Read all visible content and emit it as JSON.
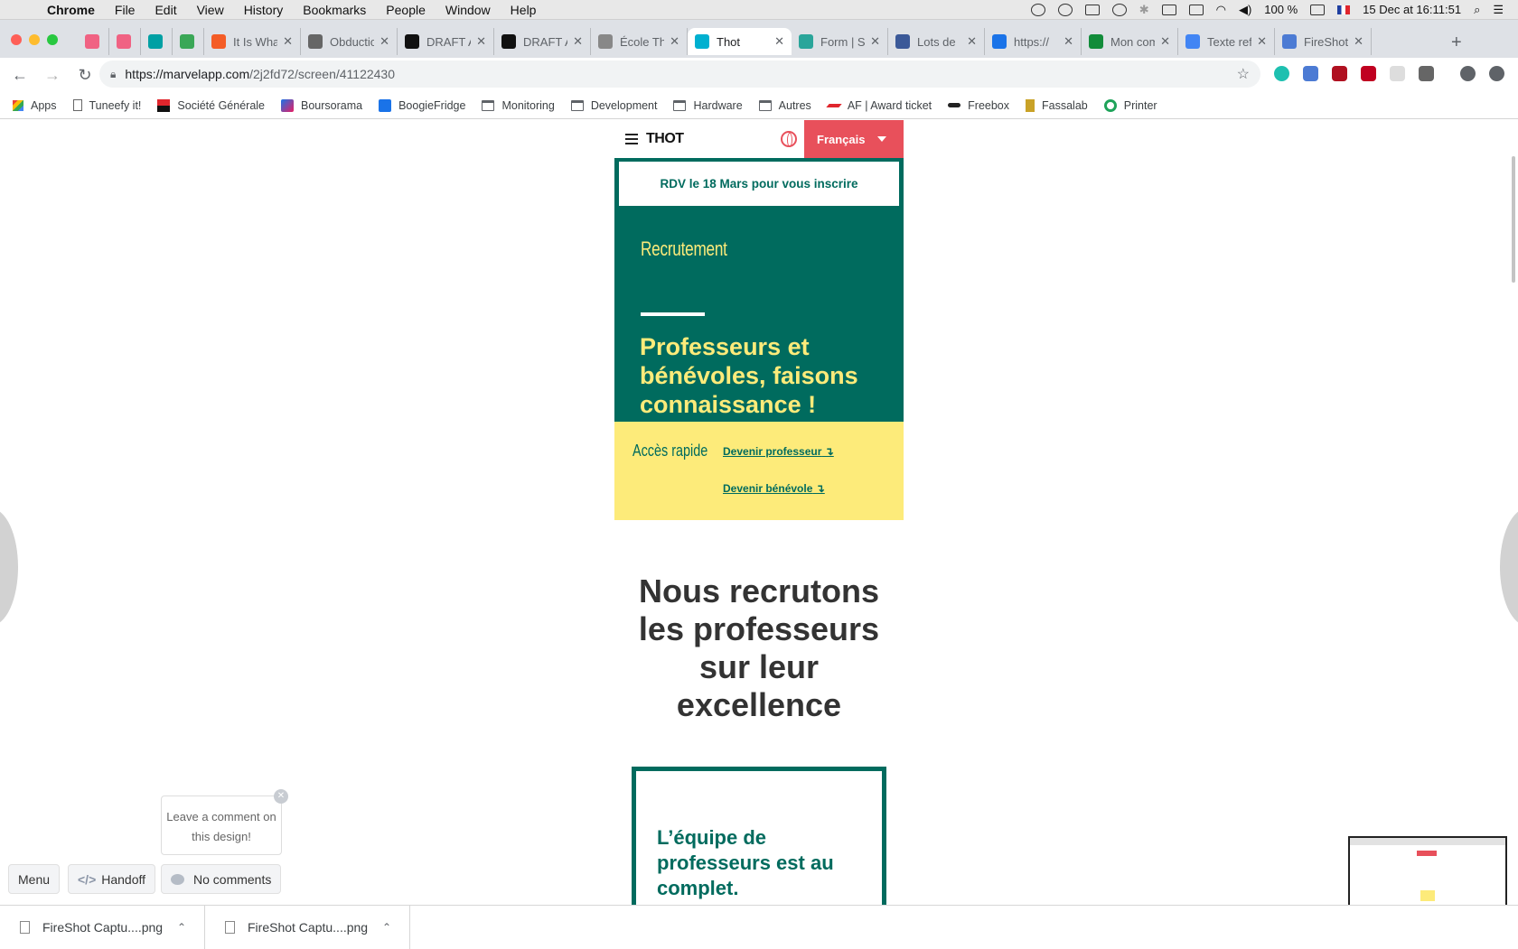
{
  "menubar": {
    "app": "Chrome",
    "items": [
      "File",
      "Edit",
      "View",
      "History",
      "Bookmarks",
      "People",
      "Window",
      "Help"
    ],
    "battery": "100 %",
    "datetime": "15 Dec at  16:11:51"
  },
  "tabs": [
    {
      "title": "",
      "color": "#f06283"
    },
    {
      "title": "",
      "color": "#f06283"
    },
    {
      "title": "",
      "color": "#00a0a4"
    },
    {
      "title": "",
      "color": "#3aa757"
    },
    {
      "title": "It Is Wha",
      "color": "#f45c26"
    },
    {
      "title": "Obductio",
      "color": "#666666"
    },
    {
      "title": "DRAFT A",
      "color": "#111111"
    },
    {
      "title": "DRAFT A",
      "color": "#111111"
    },
    {
      "title": "École Th",
      "color": "#888888"
    },
    {
      "title": "Thot",
      "color": "#00b0d0"
    },
    {
      "title": "Form | S",
      "color": "#2aa59a"
    },
    {
      "title": "Lots de",
      "color": "#3b5998"
    },
    {
      "title": "https://",
      "color": "#1a73e8"
    },
    {
      "title": "Mon com",
      "color": "#128c3a"
    },
    {
      "title": "Texte ref",
      "color": "#4285f4"
    },
    {
      "title": "FireShot",
      "color": "#4c7bd4"
    }
  ],
  "address": {
    "domain": "https://marvelapp.com",
    "path": "/2j2fd72/screen/41122430"
  },
  "bookmarks": [
    {
      "label": "Apps",
      "kind": "apps"
    },
    {
      "label": "Tuneefy it!",
      "kind": "page"
    },
    {
      "label": "Société Générale",
      "kind": "sg"
    },
    {
      "label": "Boursorama",
      "kind": "bourso"
    },
    {
      "label": "BoogieFridge",
      "kind": "dsm"
    },
    {
      "label": "Monitoring",
      "kind": "folder"
    },
    {
      "label": "Development",
      "kind": "folder"
    },
    {
      "label": "Hardware",
      "kind": "folder"
    },
    {
      "label": "Autres",
      "kind": "folder"
    },
    {
      "label": "AF | Award ticket",
      "kind": "af"
    },
    {
      "label": "Freebox",
      "kind": "freebox"
    },
    {
      "label": "Fassalab",
      "kind": "fassa"
    },
    {
      "label": "Printer",
      "kind": "printer"
    }
  ],
  "site": {
    "logo": "THOT",
    "language": "Français",
    "rdv": "RDV le 18 Mars pour vous inscrire",
    "hero_tag": "Recrutement",
    "hero_title": "Professeurs et bénévoles, faisons connaissance !",
    "quick_label": "Accès rapide",
    "quick_links": [
      "Devenir professeur",
      "Devenir bénévole"
    ],
    "section_title": "Nous recrutons les professeurs sur leur excellence",
    "card_title": "L’équipe de professeurs est au complet."
  },
  "marvel": {
    "comment_prompt": "Leave a comment on this design!",
    "menu": "Menu",
    "handoff": "Handoff",
    "comments": "No comments"
  },
  "downloads": [
    {
      "name": "FireShot Captu....png"
    },
    {
      "name": "FireShot Captu....png"
    }
  ]
}
